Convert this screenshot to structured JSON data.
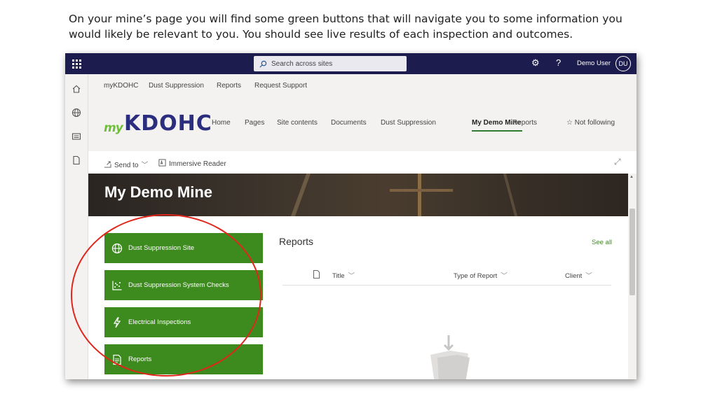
{
  "caption": "On your mine’s page you will find some green buttons that will navigate you to some information you would likely be relevant to you. You should see live results of each inspection and outcomes.",
  "suite_bar": {
    "search_placeholder": "Search across sites",
    "help_label": "?",
    "user_name": "Demo User",
    "user_initials": "DU"
  },
  "hub_nav": [
    "myKDOHC",
    "Dust Suppression",
    "Reports",
    "Request Support"
  ],
  "site": {
    "logo_my": "my",
    "logo_main": "KDOHC",
    "nav": [
      "Home",
      "Pages",
      "Site contents",
      "Documents",
      "Dust Suppression",
      "My Demo Mine",
      "Reports"
    ],
    "active_nav": "My Demo Mine",
    "follow_label": "Not following"
  },
  "command_bar": {
    "send_to": "Send to",
    "immersive_reader": "Immersive Reader"
  },
  "banner_title": "My Demo Mine",
  "quick_links": [
    {
      "label": "Dust Suppression Site",
      "icon": "globe-icon"
    },
    {
      "label": "Dust Suppression System Checks",
      "icon": "scatter-chart-icon"
    },
    {
      "label": "Electrical Inspections",
      "icon": "lightning-icon"
    },
    {
      "label": "Reports",
      "icon": "report-icon"
    }
  ],
  "reports_webpart": {
    "title": "Reports",
    "see_all": "See all",
    "columns": [
      "Title",
      "Type of Report",
      "Client"
    ]
  },
  "colors": {
    "suite_bar": "#1c1c4e",
    "button_green": "#3d8b1e",
    "highlight_oval": "#e0261b",
    "logo_blue": "#2b2e7e",
    "logo_green": "#6fbf3a"
  }
}
